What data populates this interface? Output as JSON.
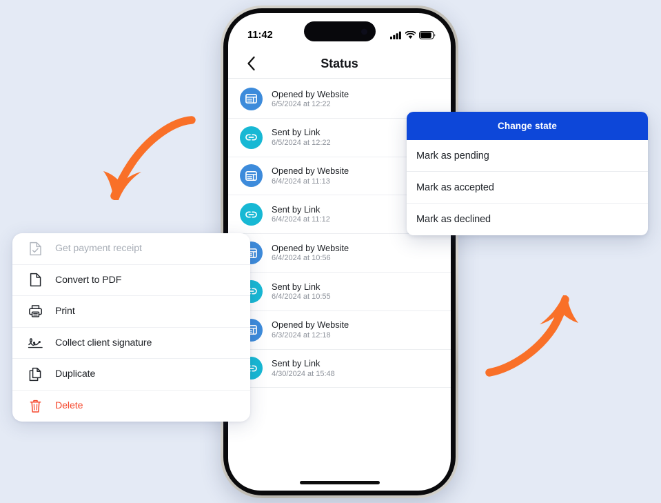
{
  "theme": {
    "background": "#e4eaf5",
    "accent_blue": "#0d47d9",
    "arrow_orange": "#f97028",
    "danger_red": "#f5472c",
    "icon_blue": "#3d8bdb",
    "icon_teal": "#17b8d4"
  },
  "phone": {
    "status_bar": {
      "time": "11:42",
      "signal_icon": "cellular-signal-icon",
      "wifi_icon": "wifi-icon",
      "battery_icon": "battery-icon"
    },
    "nav": {
      "back_icon": "chevron-left-icon",
      "title": "Status"
    },
    "list": [
      {
        "icon": "browser-window-icon",
        "icon_color": "#3d8bdb",
        "title": "Opened by Website",
        "subtitle": "6/5/2024 at 12:22"
      },
      {
        "icon": "link-icon",
        "icon_color": "#17b8d4",
        "title": "Sent by Link",
        "subtitle": "6/5/2024 at 12:22"
      },
      {
        "icon": "browser-window-icon",
        "icon_color": "#3d8bdb",
        "title": "Opened by Website",
        "subtitle": "6/4/2024 at 11:13"
      },
      {
        "icon": "link-icon",
        "icon_color": "#17b8d4",
        "title": "Sent by Link",
        "subtitle": "6/4/2024 at 11:12"
      },
      {
        "icon": "browser-window-icon",
        "icon_color": "#3d8bdb",
        "title": "Opened by Website",
        "subtitle": "6/4/2024 at 10:56"
      },
      {
        "icon": "link-icon",
        "icon_color": "#17b8d4",
        "title": "Sent by Link",
        "subtitle": "6/4/2024 at 10:55"
      },
      {
        "icon": "browser-window-icon",
        "icon_color": "#3d8bdb",
        "title": "Opened by Website",
        "subtitle": "6/3/2024 at 12:18"
      },
      {
        "icon": "link-icon",
        "icon_color": "#17b8d4",
        "title": "Sent by Link",
        "subtitle": "4/30/2024 at 15:48"
      }
    ]
  },
  "context_menu": {
    "items": [
      {
        "label": "Get payment receipt",
        "icon": "receipt-check-icon",
        "disabled": true,
        "danger": false
      },
      {
        "label": "Convert to PDF",
        "icon": "document-icon",
        "disabled": false,
        "danger": false
      },
      {
        "label": "Print",
        "icon": "printer-icon",
        "disabled": false,
        "danger": false
      },
      {
        "label": "Collect client signature",
        "icon": "signature-icon",
        "disabled": false,
        "danger": false
      },
      {
        "label": "Duplicate",
        "icon": "copy-icon",
        "disabled": false,
        "danger": false
      },
      {
        "label": "Delete",
        "icon": "trash-icon",
        "disabled": false,
        "danger": true
      }
    ]
  },
  "change_state": {
    "title": "Change state",
    "options": [
      {
        "label": "Mark as pending"
      },
      {
        "label": "Mark as accepted"
      },
      {
        "label": "Mark as declined"
      }
    ]
  },
  "annotations": {
    "arrow_down_left": "curved-arrow-down-left",
    "arrow_up_right": "curved-arrow-up-right"
  }
}
